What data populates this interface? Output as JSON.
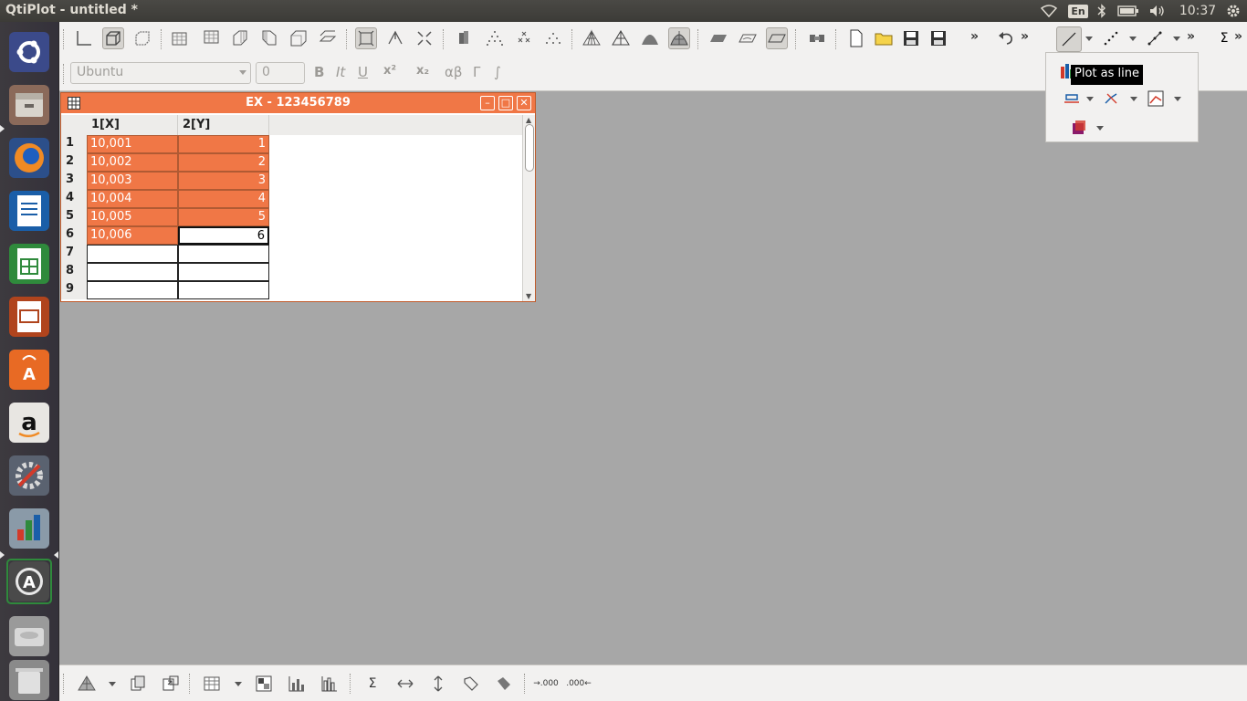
{
  "window": {
    "title": "QtiPlot - untitled *"
  },
  "tray": {
    "language": "En",
    "clock": "10:37"
  },
  "launcher": {
    "items": [
      {
        "name": "ubuntu-dash",
        "icon": "ubuntu-logo-icon"
      },
      {
        "name": "files",
        "icon": "file-manager-icon"
      },
      {
        "name": "firefox",
        "icon": "firefox-icon"
      },
      {
        "name": "writer",
        "icon": "libreoffice-writer-icon"
      },
      {
        "name": "calc",
        "icon": "libreoffice-calc-icon"
      },
      {
        "name": "impress",
        "icon": "libreoffice-impress-icon"
      },
      {
        "name": "software-center",
        "icon": "software-center-icon"
      },
      {
        "name": "amazon",
        "icon": "amazon-icon"
      },
      {
        "name": "system-settings",
        "icon": "settings-icon"
      },
      {
        "name": "qtiplot",
        "icon": "qtiplot-icon"
      },
      {
        "name": "software-updater",
        "icon": "updater-icon"
      },
      {
        "name": "drive",
        "icon": "drive-icon"
      },
      {
        "name": "trash",
        "icon": "trash-icon"
      }
    ]
  },
  "format_bar": {
    "font_name": "Ubuntu",
    "font_size": "0",
    "bold": "B",
    "italic": "It",
    "underline": "U",
    "superscript": "x²",
    "subscript": "x₂",
    "greek": "αβ",
    "gamma": "Γ",
    "integral": "∫"
  },
  "table": {
    "title": "EX - 123456789",
    "columns": [
      "1[X]",
      "2[Y]"
    ],
    "rows": [
      {
        "n": "1",
        "x": "10,001",
        "y": "1"
      },
      {
        "n": "2",
        "x": "10,002",
        "y": "2"
      },
      {
        "n": "3",
        "x": "10,003",
        "y": "3"
      },
      {
        "n": "4",
        "x": "10,004",
        "y": "4"
      },
      {
        "n": "5",
        "x": "10,005",
        "y": "5"
      },
      {
        "n": "6",
        "x": "10,006",
        "y": "6"
      },
      {
        "n": "7",
        "x": "",
        "y": ""
      },
      {
        "n": "8",
        "x": "",
        "y": ""
      },
      {
        "n": "9",
        "x": "",
        "y": ""
      }
    ],
    "selection_color": "#f07746"
  },
  "tooltip": {
    "text": "Plot as line"
  },
  "colors": {
    "panel": "#3c3b37",
    "accent": "#f07746",
    "workspace": "#a7a7a7"
  }
}
